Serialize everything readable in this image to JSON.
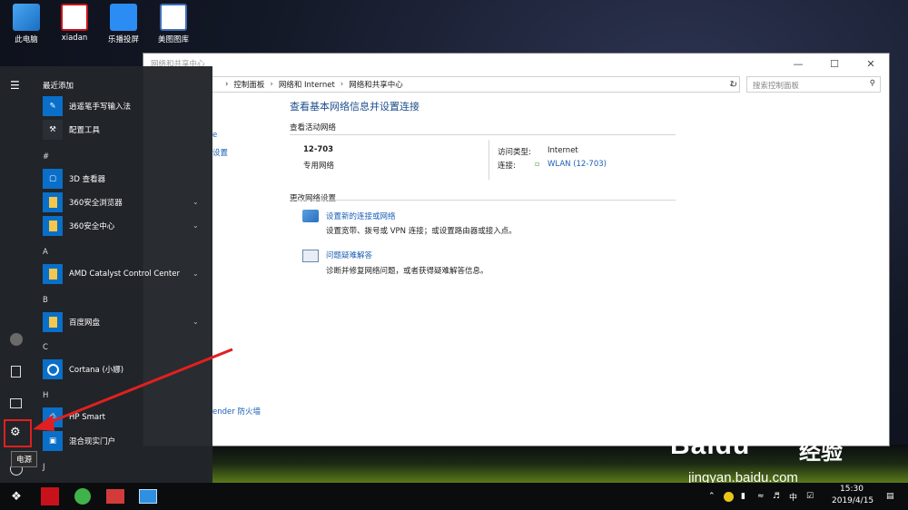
{
  "desktop": {
    "icons": [
      {
        "label": "此电脑",
        "icon": "computer-icon"
      },
      {
        "label": "xiadan",
        "icon": "stock-app-icon"
      },
      {
        "label": "乐播投屏",
        "icon": "cast-icon"
      },
      {
        "label": "美图图库",
        "icon": "photo-icon"
      }
    ]
  },
  "window": {
    "title": "网络和共享中心",
    "breadcrumb": [
      "控制面板",
      "网络和 Internet",
      "网络和共享中心"
    ],
    "search_placeholder": "搜索控制面板",
    "sidebar_fragments": [
      "设置",
      "ender 防火墙"
    ],
    "heading": "查看基本网络信息并设置连接",
    "active_networks_label": "查看活动网络",
    "network_name": "12-703",
    "network_type": "专用网络",
    "access_type_label": "访问类型:",
    "access_type_value": "Internet",
    "connection_label": "连接:",
    "connection_value": "WLAN (12-703)",
    "change_settings_label": "更改网络设置",
    "tasks": [
      {
        "title": "设置新的连接或网络",
        "desc": "设置宽带、拨号或 VPN 连接；或设置路由器或接入点。",
        "icon": "network-setup-icon"
      },
      {
        "title": "问题疑难解答",
        "desc": "诊断并修复网络问题，或者获得疑难解答信息。",
        "icon": "troubleshoot-icon"
      }
    ]
  },
  "start_menu": {
    "recent_header": "最近添加",
    "recent": [
      {
        "label": "逍遥笔手写输入法"
      },
      {
        "label": "配置工具"
      }
    ],
    "groups": [
      {
        "letter": "#",
        "apps": [
          {
            "label": "3D 查看器",
            "expand": false
          },
          {
            "label": "360安全浏览器",
            "expand": true
          },
          {
            "label": "360安全中心",
            "expand": true
          }
        ]
      },
      {
        "letter": "A",
        "apps": [
          {
            "label": "AMD Catalyst Control Center",
            "expand": true
          }
        ]
      },
      {
        "letter": "B",
        "apps": [
          {
            "label": "百度网盘",
            "expand": true
          }
        ]
      },
      {
        "letter": "C",
        "apps": [
          {
            "label": "Cortana (小娜)",
            "expand": false
          }
        ]
      },
      {
        "letter": "H",
        "apps": [
          {
            "label": "HP Smart",
            "expand": false
          },
          {
            "label": "混合现实门户",
            "expand": false
          }
        ]
      },
      {
        "letter": "J",
        "apps": []
      }
    ],
    "tooltip": "电源"
  },
  "taskbar": {
    "time": "15:30",
    "date": "2019/4/15",
    "ime": "中"
  },
  "watermark": {
    "brand": "Baidu",
    "brand_cn": "经验",
    "url": "jingyan.baidu.com"
  },
  "colors": {
    "accent": "#0a6fc8",
    "highlight_box": "#e02020",
    "arrow": "#e02020",
    "link": "#1a5fb4"
  }
}
